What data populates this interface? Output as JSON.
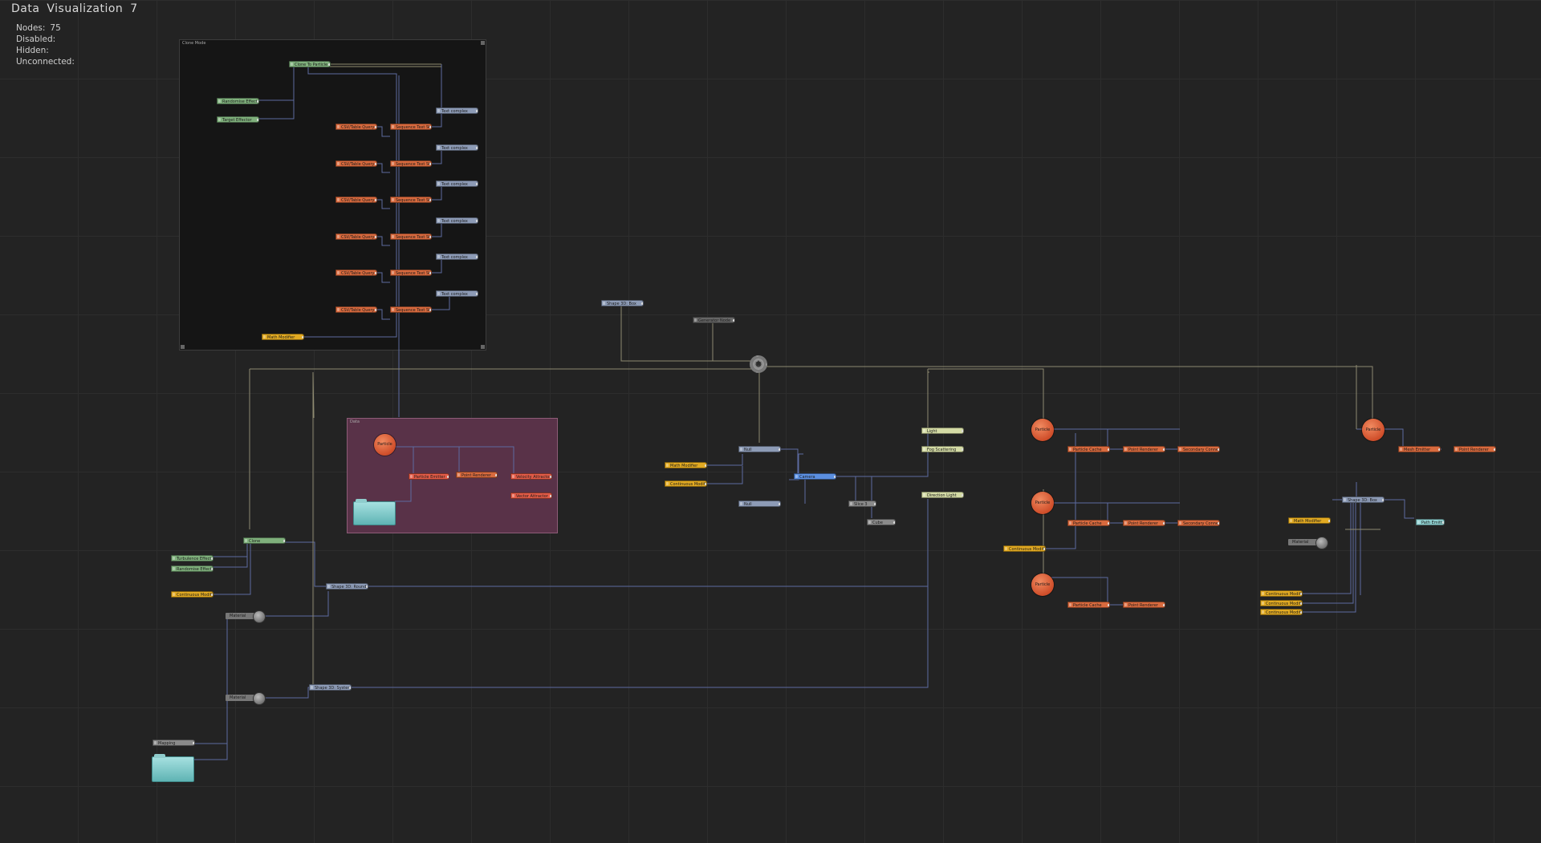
{
  "title": "Data  Visualization  7",
  "stats": {
    "nodes_label": "Nodes:",
    "nodes_value": "75",
    "disabled_label": "Disabled:",
    "hidden_label": "Hidden:",
    "unconnected_label": "Unconnected:"
  },
  "groups": {
    "label_one": "Clone Mode",
    "label_two": "Data"
  },
  "nodes": {
    "clone_to_particle": "Clone To Particle",
    "randomise_effector": "Randomise Effector",
    "target_effector": "Target Effector",
    "csv_table_query": "CSV/Table Query",
    "sequence_text": "Sequence Text Str..",
    "text_complex": "Text complex",
    "math_modifier": "Math Modifier",
    "shape_3d_box": "Shape 3D: Box",
    "generator_node": "Generator Node",
    "null": "Null",
    "camera": "Camera",
    "slice": "Slice 3",
    "cube": "Cube",
    "light": "Light",
    "fog_scattering": "Fog Scattering",
    "direction_light": "Direction Light",
    "particle": "Particle",
    "particle_emitter": "Particle Emitter",
    "point_renderer": "Point Renderer",
    "velocity_attractor": "Velocity Attractor",
    "vector_attractor": "Vector Attractor",
    "clone": "Clone",
    "turbulence_effector": "Turbulence Effector",
    "random_effector": "Randomise Effector",
    "continuous_modifier": "Continuous Modifier",
    "shape_3d_rounded": "Shape 3D: Rounde...",
    "material": "Material",
    "shape_3d_system": "Shape 3D: System",
    "mapping": "Mapping",
    "particle_cache": "Particle Cache",
    "secondary_connector": "Secondary Connect..",
    "mesh_emitter": "Mesh Emitter",
    "path_emitter": "Path Emitt.."
  },
  "colors": {
    "background": "#232323",
    "orange_node": "#d86a3e",
    "slate_node": "#8d9bb6",
    "green_node": "#7fb07c",
    "yellow_node": "#e2aa22",
    "wire": "#5d6ba0",
    "group_one": "#161616",
    "group_two": "#5a3348"
  }
}
